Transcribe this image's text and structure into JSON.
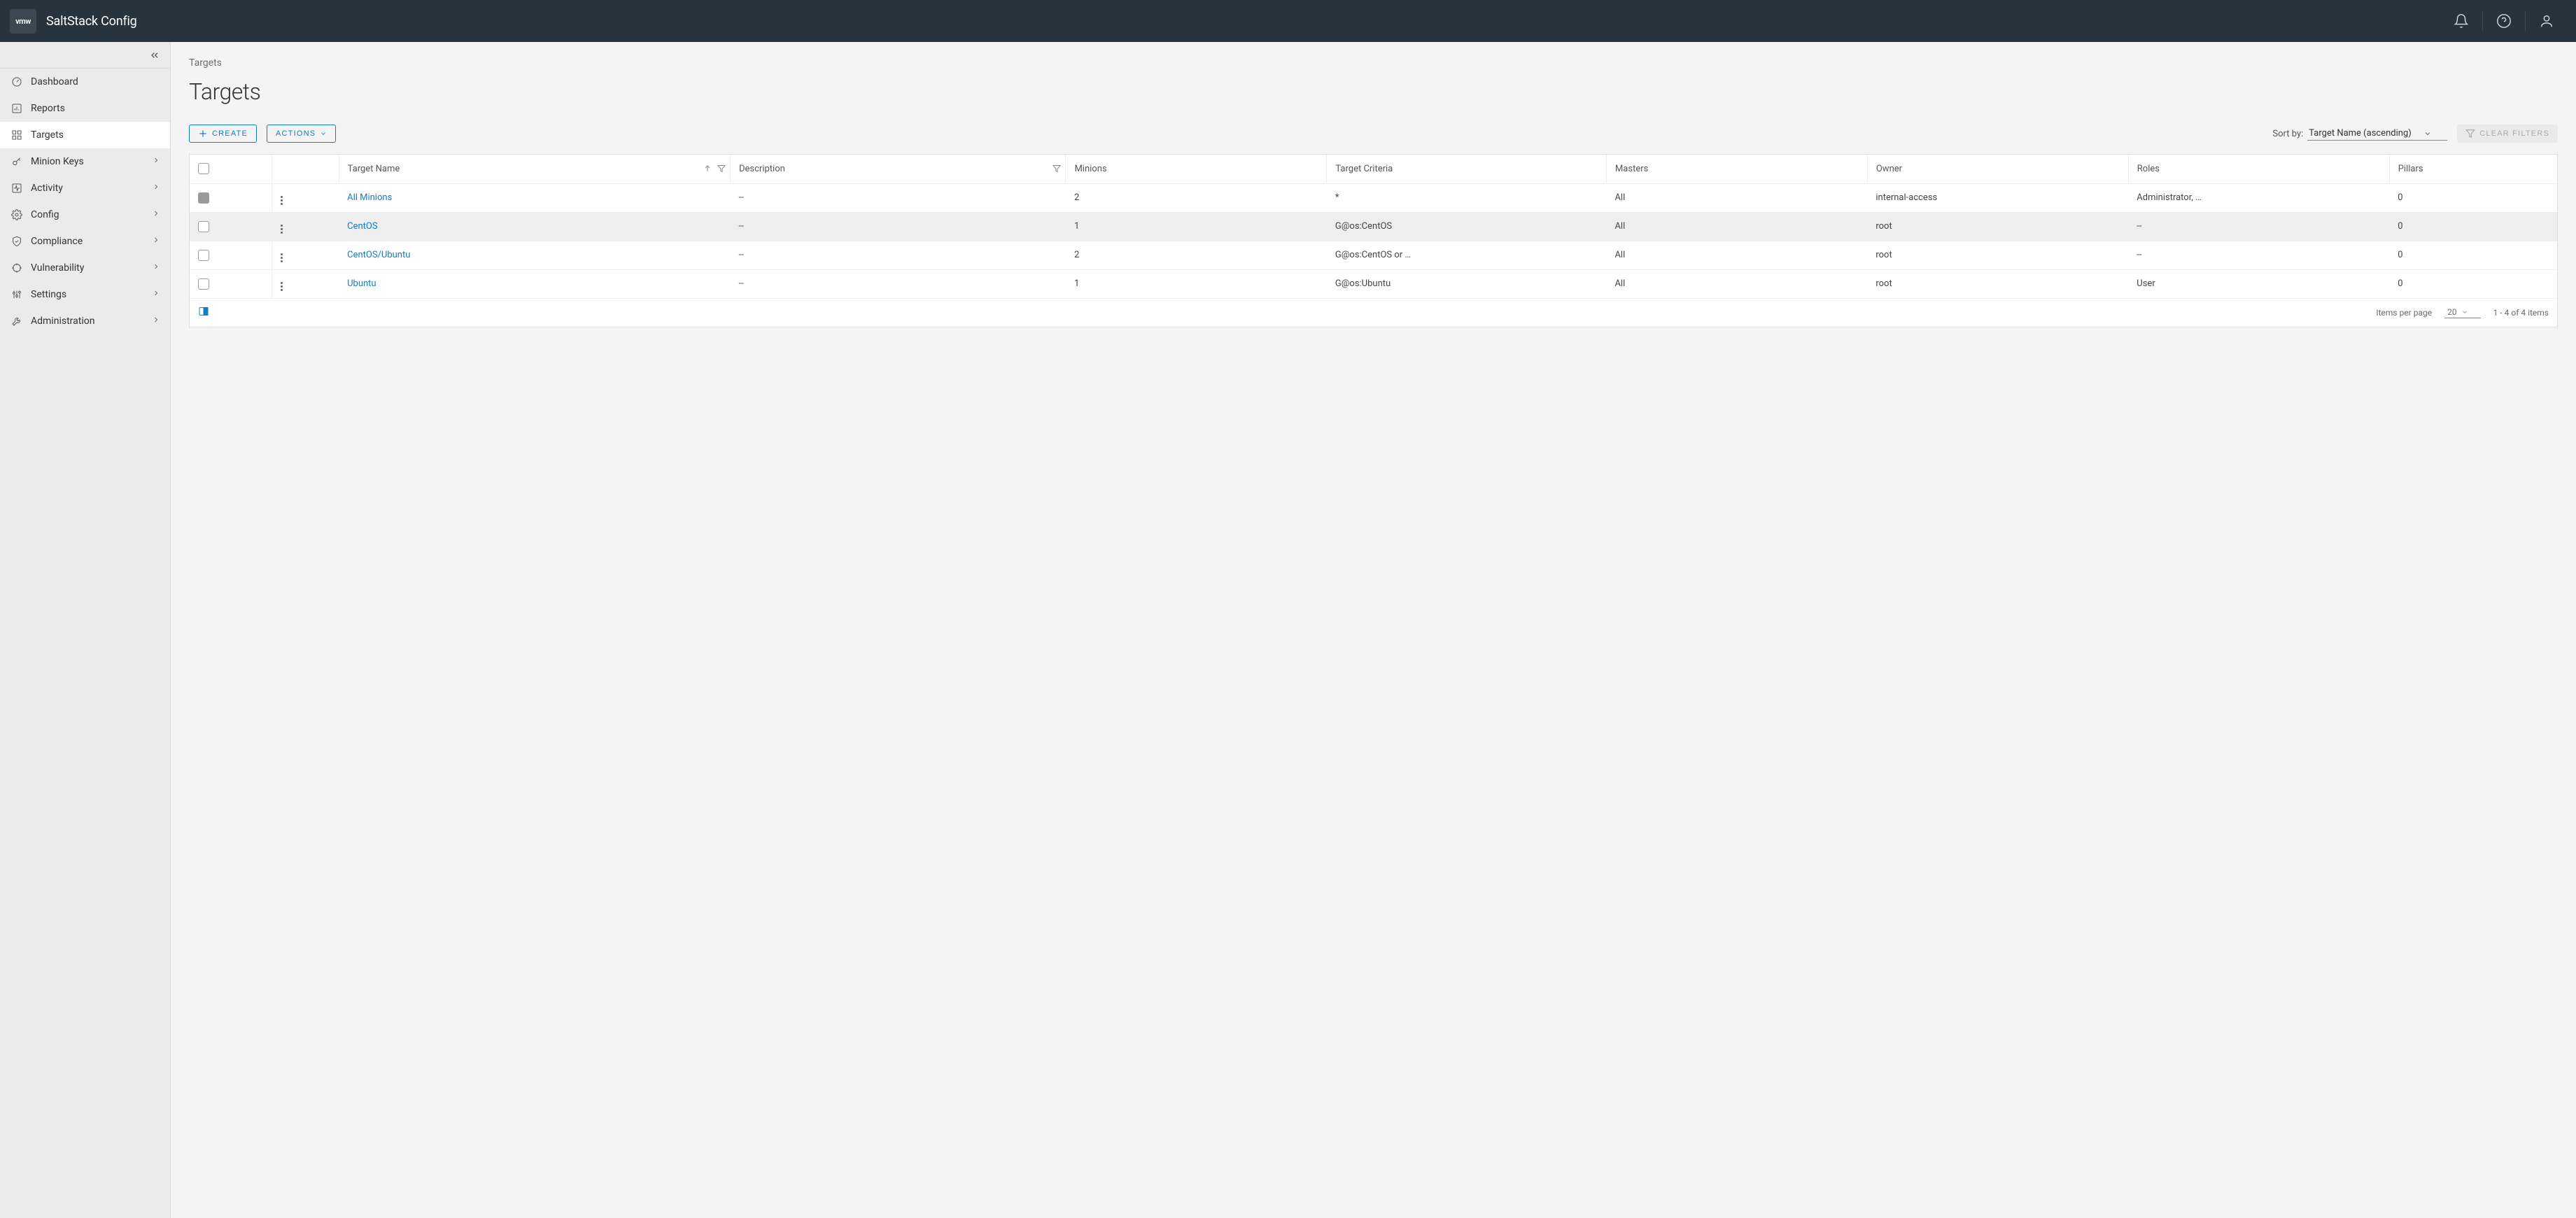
{
  "header": {
    "logo_text": "vmw",
    "app_title": "SaltStack Config"
  },
  "sidebar": {
    "items": [
      {
        "icon": "gauge",
        "label": "Dashboard",
        "selected": false,
        "expandable": false
      },
      {
        "icon": "barchart",
        "label": "Reports",
        "selected": false,
        "expandable": false
      },
      {
        "icon": "grid",
        "label": "Targets",
        "selected": true,
        "expandable": false
      },
      {
        "icon": "key",
        "label": "Minion Keys",
        "selected": false,
        "expandable": true
      },
      {
        "icon": "activity",
        "label": "Activity",
        "selected": false,
        "expandable": true
      },
      {
        "icon": "gear",
        "label": "Config",
        "selected": false,
        "expandable": true
      },
      {
        "icon": "shield",
        "label": "Compliance",
        "selected": false,
        "expandable": true
      },
      {
        "icon": "target",
        "label": "Vulnerability",
        "selected": false,
        "expandable": true
      },
      {
        "icon": "sliders",
        "label": "Settings",
        "selected": false,
        "expandable": true
      },
      {
        "icon": "wrench",
        "label": "Administration",
        "selected": false,
        "expandable": true
      }
    ]
  },
  "main": {
    "breadcrumb": "Targets",
    "page_title": "Targets",
    "toolbar": {
      "create_label": "CREATE",
      "actions_label": "ACTIONS",
      "sort_label": "Sort by:",
      "sort_value": "Target Name (ascending)",
      "clear_filters_label": "CLEAR FILTERS"
    },
    "table": {
      "columns": [
        "Target Name",
        "Description",
        "Minions",
        "Target Criteria",
        "Masters",
        "Owner",
        "Roles",
        "Pillars"
      ],
      "rows": [
        {
          "checked": true,
          "hovered": false,
          "name": "All Minions",
          "description": "--",
          "minions": "2",
          "criteria": "*",
          "masters": "All",
          "owner": "internal-access",
          "roles": "Administrator, …",
          "pillars": "0"
        },
        {
          "checked": false,
          "hovered": true,
          "name": "CentOS",
          "description": "--",
          "minions": "1",
          "criteria": "G@os:CentOS",
          "masters": "All",
          "owner": "root",
          "roles": "--",
          "pillars": "0"
        },
        {
          "checked": false,
          "hovered": false,
          "name": "CentOS/Ubuntu",
          "description": "--",
          "minions": "2",
          "criteria": "G@os:CentOS or …",
          "masters": "All",
          "owner": "root",
          "roles": "--",
          "pillars": "0"
        },
        {
          "checked": false,
          "hovered": false,
          "name": "Ubuntu",
          "description": "--",
          "minions": "1",
          "criteria": "G@os:Ubuntu",
          "masters": "All",
          "owner": "root",
          "roles": "User",
          "pillars": "0"
        }
      ]
    },
    "footer": {
      "items_per_page_label": "Items per page",
      "page_size": "20",
      "range_text": "1 - 4 of 4 items"
    }
  }
}
